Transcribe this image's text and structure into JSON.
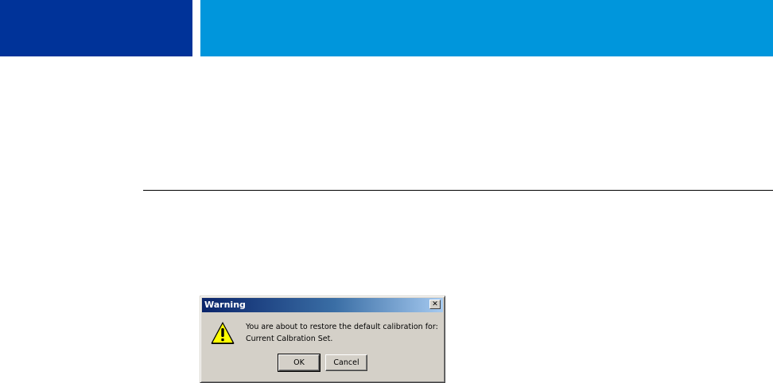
{
  "header": {
    "dark_band_color": "#003399",
    "light_band_color": "#0096dc"
  },
  "dialog": {
    "title": "Warning",
    "close_glyph": "✕",
    "icon": "warning-icon",
    "message_line1": "You are about to restore the default calibration for:",
    "message_line2": "Current Calbration Set.",
    "ok_label": "OK",
    "cancel_label": "Cancel"
  }
}
